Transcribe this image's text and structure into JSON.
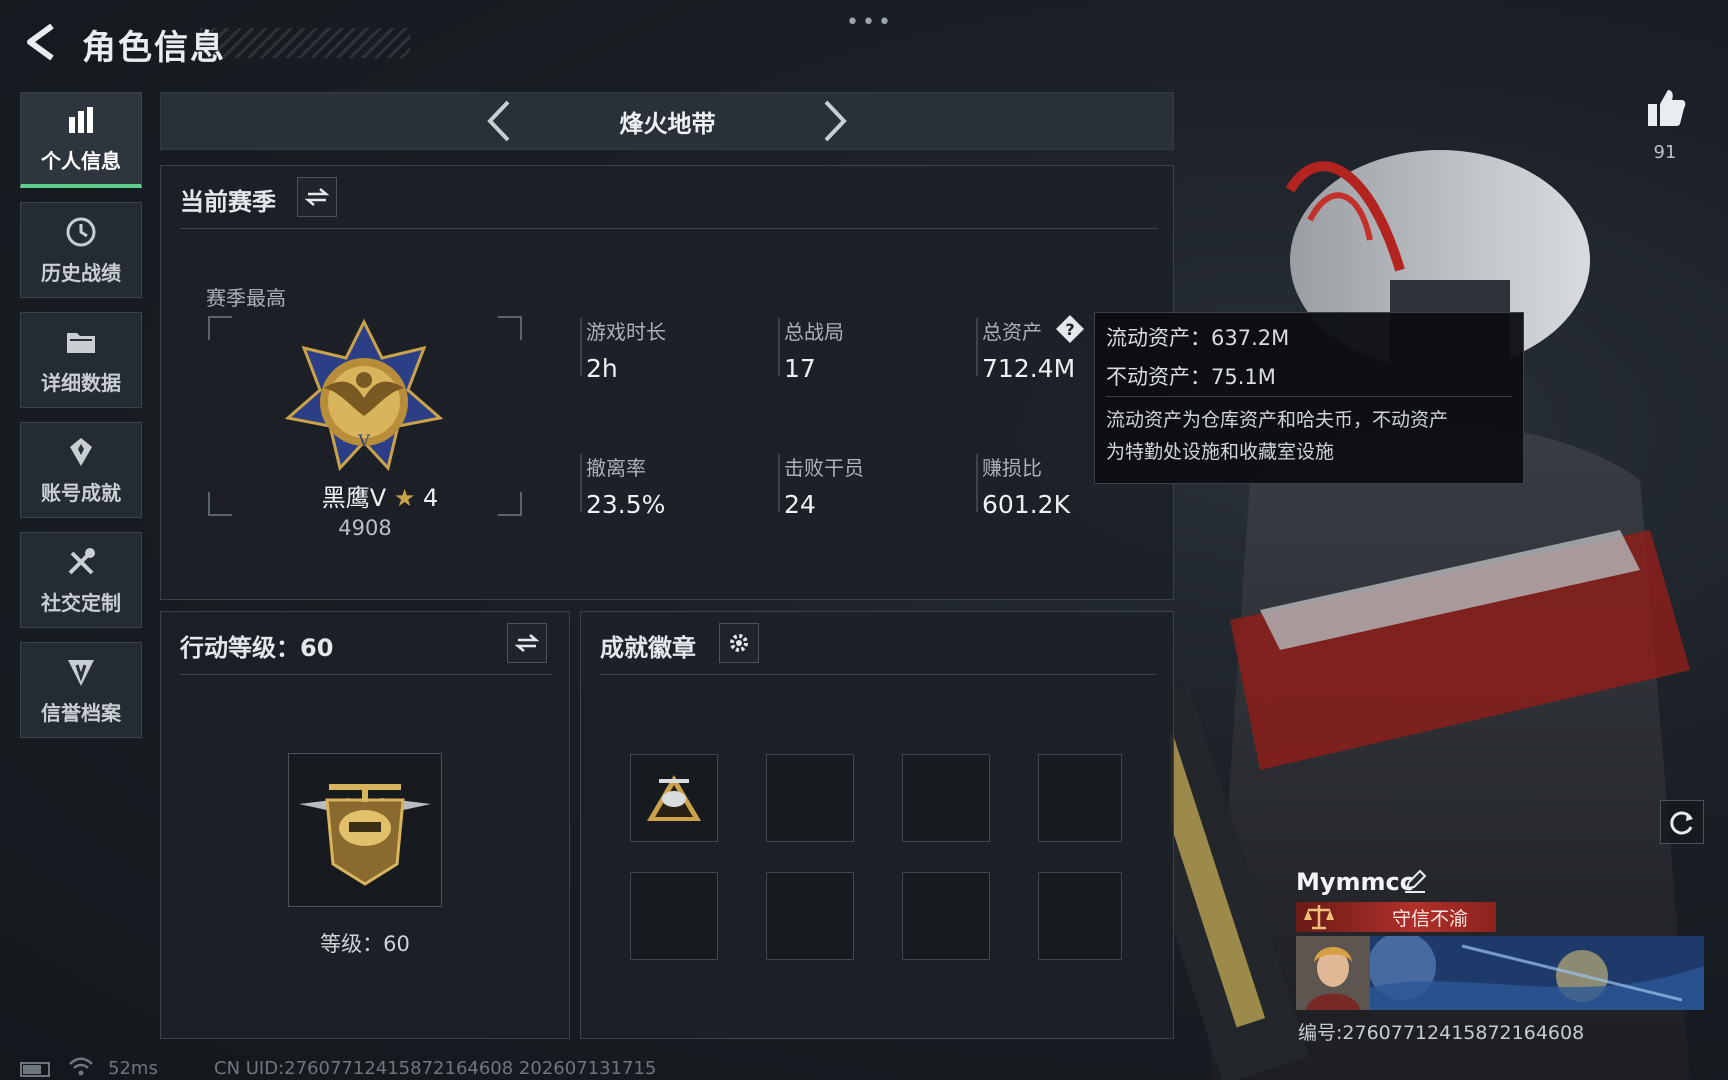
{
  "header": {
    "title": "角色信息",
    "more": "•••"
  },
  "sidebar": {
    "items": [
      {
        "label": "个人信息",
        "icon": "bar-chart-icon",
        "active": true
      },
      {
        "label": "历史战绩",
        "icon": "clock-icon",
        "active": false
      },
      {
        "label": "详细数据",
        "icon": "folder-icon",
        "active": false
      },
      {
        "label": "账号成就",
        "icon": "achievement-icon",
        "active": false
      },
      {
        "label": "社交定制",
        "icon": "tools-icon",
        "active": false
      },
      {
        "label": "信誉档案",
        "icon": "shield-icon",
        "active": false
      }
    ]
  },
  "mode": {
    "title": "烽火地带"
  },
  "season": {
    "title": "当前赛季",
    "best_label": "赛季最高",
    "rank_name": "黑鹰V",
    "rank_stars": "4",
    "rank_score": "4908",
    "stats": [
      {
        "label": "游戏时长",
        "value": "2h"
      },
      {
        "label": "总战局",
        "value": "17"
      },
      {
        "label": "总资产",
        "value": "712.4M"
      },
      {
        "label": "撤离率",
        "value": "23.5%"
      },
      {
        "label": "击败干员",
        "value": "24"
      },
      {
        "label": "赚损比",
        "value": "601.2K"
      }
    ]
  },
  "tooltip": {
    "liquid": "流动资产：637.2M",
    "fixed": "不动资产：75.1M",
    "note_line1": "流动资产为仓库资产和哈夫币，不动资产",
    "note_line2": "为特勤处设施和收藏室设施"
  },
  "level": {
    "title": "行动等级：60",
    "level_text": "等级：60"
  },
  "badges": {
    "title": "成就徽章"
  },
  "profile": {
    "likes": "91",
    "name": "Mymmcc",
    "honor": "守信不渝",
    "id": "编号:276077124158721646​08"
  },
  "status": {
    "ping": "52ms",
    "uid": "CN UID:276077124158721646​08 202607131715"
  },
  "colors": {
    "accent": "#5fd08a",
    "honor": "#b2302a",
    "panel": "#1c2127"
  }
}
